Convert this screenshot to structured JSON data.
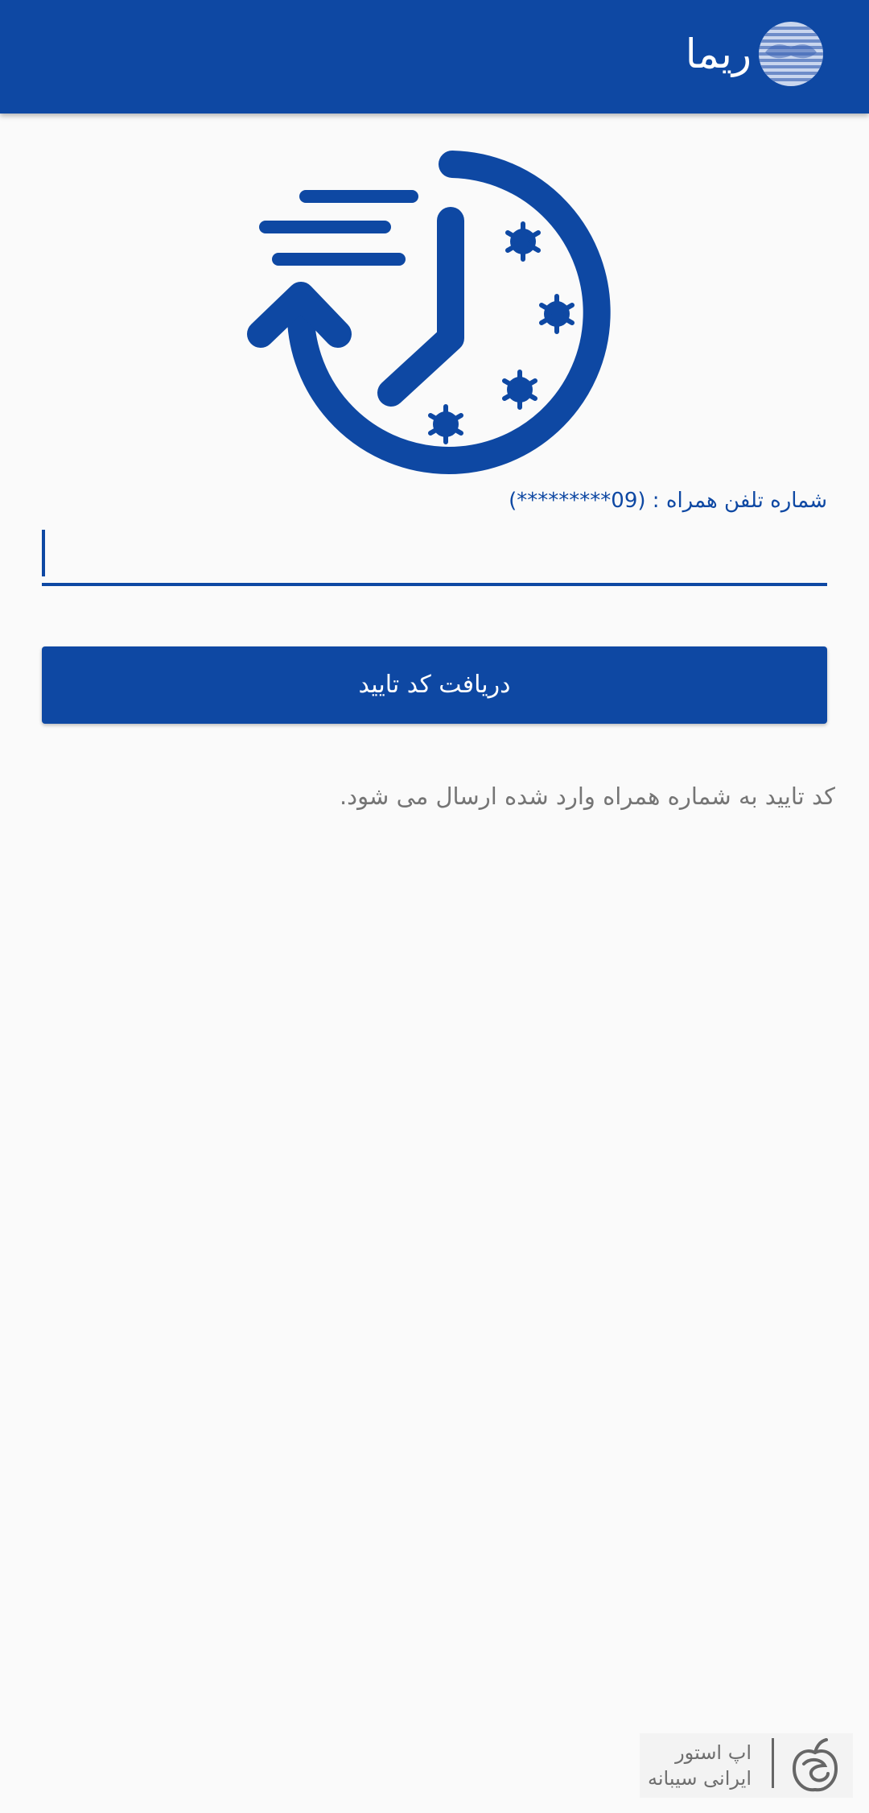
{
  "app": {
    "title": "ریما",
    "logo_icon": "rima-logo-icon"
  },
  "theme": {
    "primary": "#0e48a3",
    "background": "#fafafa",
    "hint_text": "#757575"
  },
  "hero": {
    "icon": "clock-history-icon"
  },
  "form": {
    "phone_label": "شماره تلفن همراه : (09*********)",
    "phone_value": "",
    "submit_label": "دریافت کد تایید"
  },
  "info": {
    "text": "کد تایید به شماره همراه وارد شده ارسال می شود."
  },
  "store_badge": {
    "line1": "اپ استور",
    "line2": "ایرانی سیبانه",
    "icon": "sibaneh-apple-icon"
  }
}
